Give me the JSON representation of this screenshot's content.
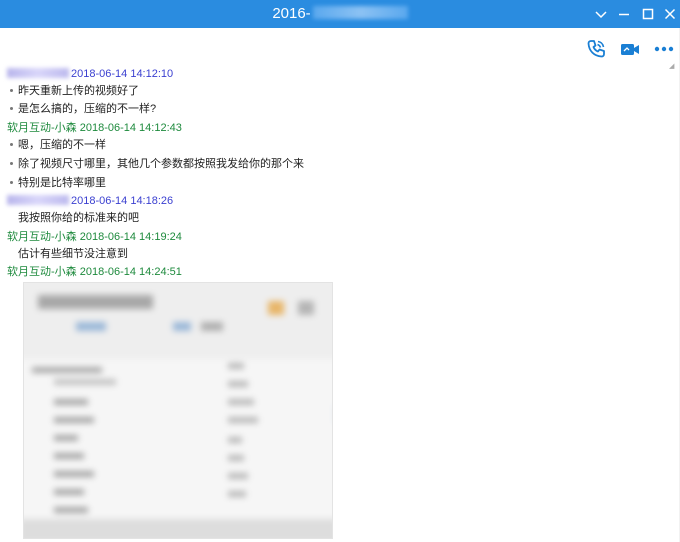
{
  "window": {
    "title_prefix": "2016-",
    "accent": "#2a8ce0"
  },
  "toolbar": {
    "icons": [
      "phone-icon",
      "video-camera-icon",
      "more-icon"
    ]
  },
  "messages": [
    {
      "type": "header",
      "sender": "",
      "time": "2018-06-14 14:12:10",
      "side": "peer",
      "name_blurred": true
    },
    {
      "type": "text",
      "text": "昨天重新上传的视频好了",
      "bullet": true
    },
    {
      "type": "text",
      "text": "是怎么搞的，压缩的不一样?",
      "bullet": true
    },
    {
      "type": "header",
      "sender": "软月互动-小森",
      "time": "2018-06-14 14:12:43",
      "side": "me"
    },
    {
      "type": "text",
      "text": "嗯，压缩的不一样",
      "bullet": true
    },
    {
      "type": "text",
      "text": "除了视频尺寸哪里，其他几个参数都按照我发给你的那个来",
      "bullet": true
    },
    {
      "type": "text",
      "text": "特别是比特率哪里",
      "bullet": true
    },
    {
      "type": "header",
      "sender": "",
      "time": "2018-06-14 14:18:26",
      "side": "peer",
      "name_blurred": true
    },
    {
      "type": "text",
      "text": "我按照你给的标准来的吧",
      "bullet": false
    },
    {
      "type": "header",
      "sender": "软月互动-小森",
      "time": "2018-06-14 14:19:24",
      "side": "me"
    },
    {
      "type": "text",
      "text": "估计有些细节没注意到",
      "bullet": false
    },
    {
      "type": "header",
      "sender": "软月互动-小森",
      "time": "2018-06-14 14:24:51",
      "side": "me"
    },
    {
      "type": "image",
      "blurred": true
    }
  ],
  "colors": {
    "peer_name": "#3a3fd0",
    "my_name": "#1e8a3d",
    "text": "#222222",
    "icon": "#1a7fd4"
  }
}
